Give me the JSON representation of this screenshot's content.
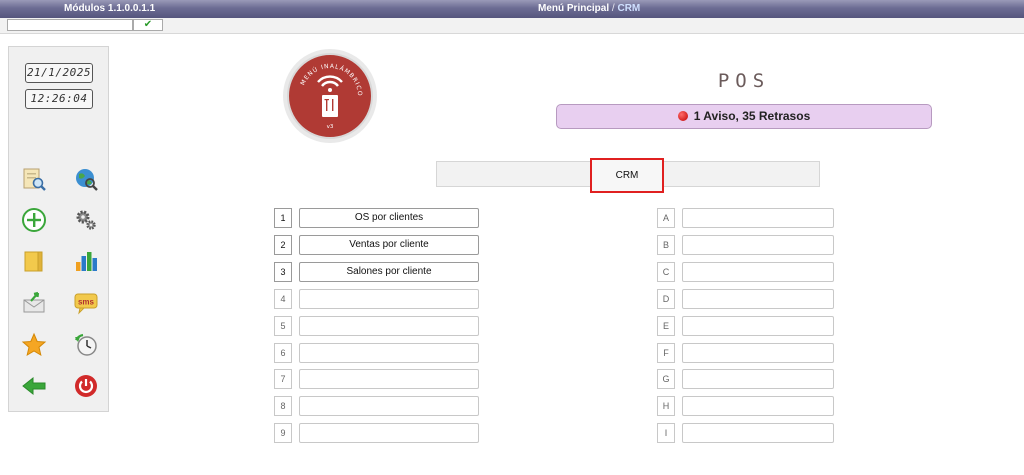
{
  "header": {
    "modules_label": "Módulos 1.1.0.0.1.1",
    "breadcrumb_root": "Menú Principal",
    "breadcrumb_sep": "/",
    "breadcrumb_current": "CRM"
  },
  "subbar": {
    "search_value": "",
    "ok_icon": "check-icon"
  },
  "clock": {
    "date": "21/1/2025",
    "time": "12:26:04"
  },
  "sidebar_icons": [
    "search-document-icon",
    "globe-search-icon",
    "add-circle-icon",
    "gears-icon",
    "folder-icon",
    "bar-chart-icon",
    "mail-send-icon",
    "sms-icon",
    "star-icon",
    "clock-refresh-icon",
    "back-arrow-icon",
    "power-icon"
  ],
  "logo": {
    "ring_text": "MENÚ INALÁMBRICO",
    "bottom_text": "v3"
  },
  "pos": {
    "title": "POS",
    "alert_text": "1 Aviso, 35 Retrasos"
  },
  "section": {
    "button_label": "CRM"
  },
  "left_options": [
    {
      "key": "1",
      "label": "OS por clientes"
    },
    {
      "key": "2",
      "label": "Ventas por cliente"
    },
    {
      "key": "3",
      "label": "Salones por cliente"
    },
    {
      "key": "4",
      "label": ""
    },
    {
      "key": "5",
      "label": ""
    },
    {
      "key": "6",
      "label": ""
    },
    {
      "key": "7",
      "label": ""
    },
    {
      "key": "8",
      "label": ""
    },
    {
      "key": "9",
      "label": ""
    }
  ],
  "right_options": [
    {
      "key": "A",
      "label": ""
    },
    {
      "key": "B",
      "label": ""
    },
    {
      "key": "C",
      "label": ""
    },
    {
      "key": "D",
      "label": ""
    },
    {
      "key": "E",
      "label": ""
    },
    {
      "key": "F",
      "label": ""
    },
    {
      "key": "G",
      "label": ""
    },
    {
      "key": "H",
      "label": ""
    },
    {
      "key": "I",
      "label": ""
    }
  ],
  "colors": {
    "accent_red": "#b03a34",
    "alert_bg": "#e8cff0",
    "header_bg": "#6c6c93",
    "highlight": "#e02020"
  }
}
